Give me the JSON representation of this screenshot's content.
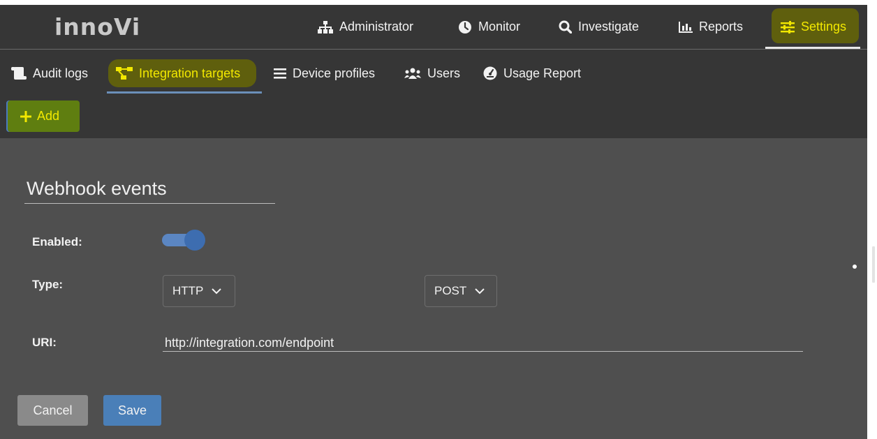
{
  "brand": {
    "logo_text": "innoVi"
  },
  "top_nav": [
    {
      "label": "Administrator",
      "icon": "sitemap-icon"
    },
    {
      "label": "Monitor",
      "icon": "clock-icon"
    },
    {
      "label": "Investigate",
      "icon": "search-icon"
    },
    {
      "label": "Reports",
      "icon": "bar-chart-icon"
    },
    {
      "label": "Settings",
      "icon": "sliders-icon",
      "active": true
    }
  ],
  "sub_nav": [
    {
      "label": "Audit logs",
      "icon": "scroll-icon"
    },
    {
      "label": "Integration targets",
      "icon": "project-diagram-icon",
      "active": true
    },
    {
      "label": "Device profiles",
      "icon": "list-icon"
    },
    {
      "label": "Users",
      "icon": "users-icon"
    },
    {
      "label": "Usage Report",
      "icon": "gauge-icon"
    }
  ],
  "actions": {
    "add_label": "Add"
  },
  "form": {
    "title": "Webhook events",
    "enabled_label": "Enabled:",
    "enabled": true,
    "type_label": "Type:",
    "type_value": "HTTP",
    "method_value": "POST",
    "uri_label": "URI:",
    "uri_value": "http://integration.com/endpoint",
    "cancel_label": "Cancel",
    "save_label": "Save"
  },
  "colors": {
    "background": "#4f4f4f",
    "bar": "#363636",
    "active_text": "#f2e800",
    "highlight": "#6e6e00",
    "accent": "#4a7fb8"
  }
}
